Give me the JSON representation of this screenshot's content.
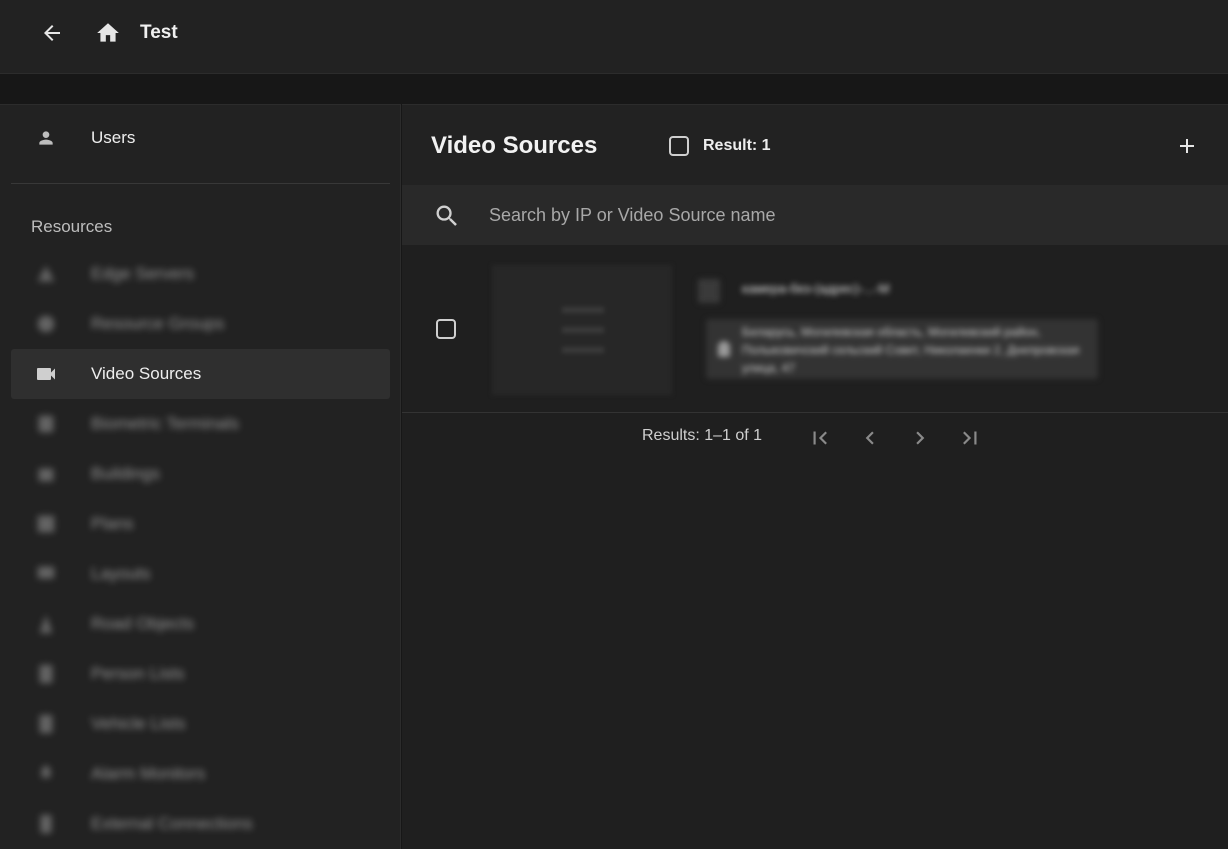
{
  "topbar": {
    "title": "Test",
    "back_icon": "arrow-left-icon",
    "home_icon": "home-icon"
  },
  "sidebar": {
    "users_label": "Users",
    "section_label": "Resources",
    "items": [
      {
        "label": "Edge Servers",
        "icon": "server-icon",
        "blurred": true
      },
      {
        "label": "Resource Groups",
        "icon": "groups-icon",
        "blurred": true
      },
      {
        "label": "Video Sources",
        "icon": "video-camera-icon",
        "blurred": false,
        "active": true
      },
      {
        "label": "Biometric Terminals",
        "icon": "terminal-icon",
        "blurred": true
      },
      {
        "label": "Buildings",
        "icon": "building-icon",
        "blurred": true
      },
      {
        "label": "Plans",
        "icon": "plan-icon",
        "blurred": true
      },
      {
        "label": "Layouts",
        "icon": "layout-icon",
        "blurred": true
      },
      {
        "label": "Road Objects",
        "icon": "road-icon",
        "blurred": true
      },
      {
        "label": "Person Lists",
        "icon": "list-icon",
        "blurred": true
      },
      {
        "label": "Vehicle Lists",
        "icon": "list-icon",
        "blurred": true
      },
      {
        "label": "Alarm Monitors",
        "icon": "alarm-icon",
        "blurred": true
      },
      {
        "label": "External Connections",
        "icon": "connection-icon",
        "blurred": true
      }
    ]
  },
  "main": {
    "title": "Video Sources",
    "result_label": "Result: 1",
    "search_placeholder": "Search by IP or Video Source name",
    "row": {
      "name": "камера-без-(адрес)-...-М",
      "address": "Беларусь, Могилевская область, Могилевский район, Полыковичский сельский Совет, Николаенки 2, Днепровская улица, 47"
    },
    "pagination": {
      "results_text": "Results: 1–1 of 1"
    }
  },
  "colors": {
    "background": "#171717",
    "panel": "#222222",
    "active_item": "#2f2f2f",
    "text": "#e8e8e8"
  }
}
